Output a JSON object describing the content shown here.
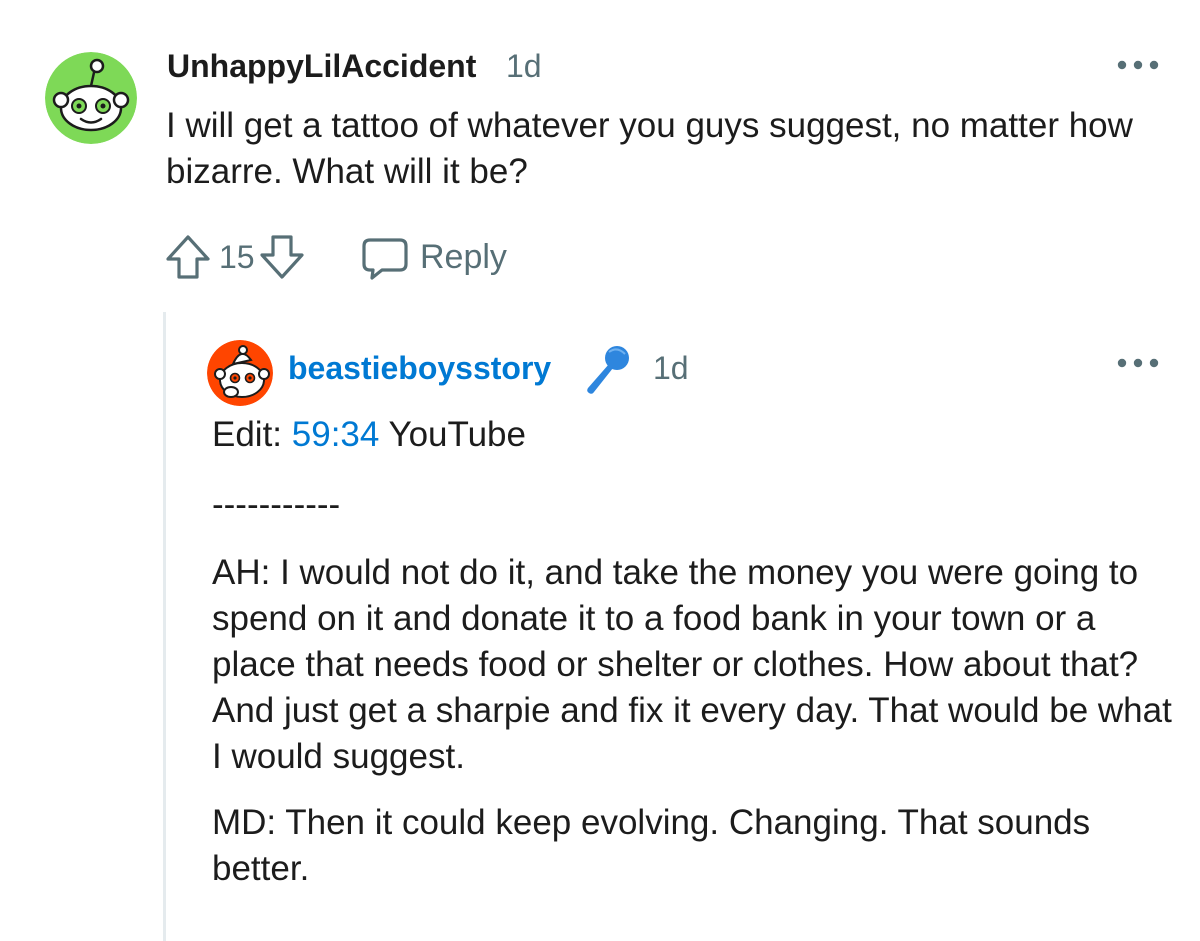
{
  "parent_comment": {
    "username": "UnhappyLilAccident",
    "age": "1d",
    "body": "I will get a tattoo of whatever you guys suggest, no matter how bizarre. What will it be?",
    "vote_count": "15",
    "reply_label": "Reply",
    "avatar_color": "#7ed957"
  },
  "child_comment": {
    "username": "beastieboysstory",
    "age": "1d",
    "flair_icon": "microphone-icon",
    "edit_prefix": "Edit: ",
    "edit_link": "59:34",
    "edit_suffix": " YouTube",
    "divider": "-----------",
    "paragraph_ah": "AH: I would not do it, and take the money you were going to spend on it and donate it to a food bank in your town or a place that needs food or shelter or clothes. How about that? And just get a sharpie and fix it every day. That would be what I would suggest.",
    "paragraph_md": "MD: Then it could keep evolving. Changing. That sounds better.",
    "avatar_color": "#ff4500",
    "username_color": "#0079d3"
  },
  "colors": {
    "meta_text": "#576f76",
    "thread_line": "#e5ebee"
  }
}
